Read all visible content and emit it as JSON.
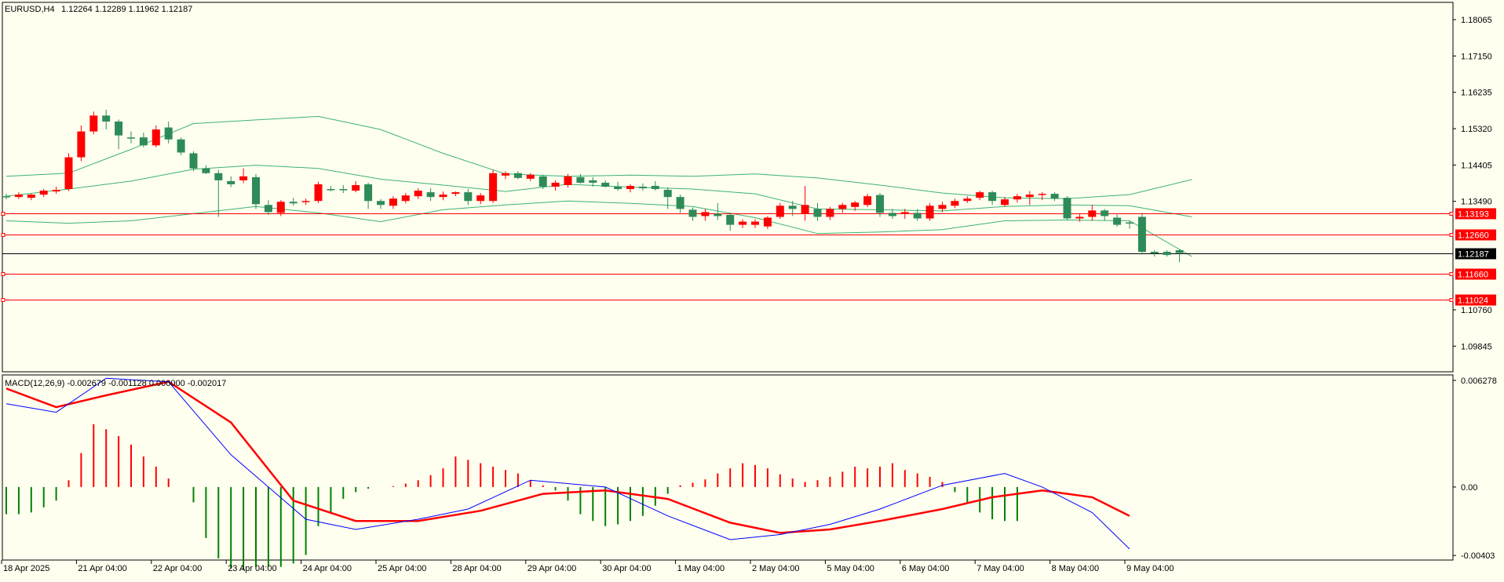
{
  "main_header": {
    "symbol": "EURUSD,H4",
    "ohlc": "1.12264 1.12289 1.11962 1.12187"
  },
  "macd_header": {
    "label": "MACD(12,26,9) -0.002679 -0.001128 0.000000 -0.002017"
  },
  "colors": {
    "background": "#fffff0",
    "bull": "#2e8b57",
    "bear": "#ff0000",
    "band": "#3cb371",
    "level_line": "#ff0000",
    "price_line": "#000000",
    "macd_line": "#0000ff",
    "signal_line": "#ff0000",
    "hist_pos": "#ff0000",
    "hist_neg": "#008000"
  },
  "chart_data": [
    {
      "type": "candlestick",
      "title": "EURUSD,H4",
      "ylim": [
        1.092,
        1.185
      ],
      "y_ticks": [
        "1.18065",
        "1.17150",
        "1.16235",
        "1.15320",
        "1.14405",
        "1.13490",
        "1.10760",
        "1.09845"
      ],
      "y_tick_values": [
        1.18065,
        1.1715,
        1.16235,
        1.1532,
        1.14405,
        1.1349,
        1.1076,
        1.09845
      ],
      "x_labels": [
        "18 Apr 2025",
        "21 Apr 04:00",
        "22 Apr 04:00",
        "23 Apr 04:00",
        "24 Apr 04:00",
        "25 Apr 04:00",
        "28 Apr 04:00",
        "29 Apr 04:00",
        "30 Apr 04:00",
        "1 May 04:00",
        "2 May 04:00",
        "5 May 04:00",
        "6 May 04:00",
        "7 May 04:00",
        "8 May 04:00",
        "9 May 04:00"
      ],
      "x_label_bars": [
        0,
        6,
        12,
        18,
        24,
        30,
        36,
        42,
        48,
        54,
        60,
        66,
        72,
        78,
        84,
        90
      ],
      "candles": [
        [
          1.1362,
          1.1368,
          1.1354,
          1.136
        ],
        [
          1.136,
          1.1372,
          1.1355,
          1.1366
        ],
        [
          1.1358,
          1.1368,
          1.1352,
          1.1366
        ],
        [
          1.1366,
          1.138,
          1.136,
          1.1376
        ],
        [
          1.1374,
          1.1386,
          1.1368,
          1.1378
        ],
        [
          1.138,
          1.147,
          1.1375,
          1.146
        ],
        [
          1.146,
          1.154,
          1.145,
          1.1525
        ],
        [
          1.1525,
          1.1575,
          1.1518,
          1.1565
        ],
        [
          1.1565,
          1.158,
          1.153,
          1.155
        ],
        [
          1.155,
          1.1555,
          1.148,
          1.1515
        ],
        [
          1.151,
          1.1525,
          1.1495,
          1.1508
        ],
        [
          1.151,
          1.1522,
          1.1485,
          1.149
        ],
        [
          1.149,
          1.154,
          1.1485,
          1.153
        ],
        [
          1.1535,
          1.155,
          1.1495,
          1.1505
        ],
        [
          1.1505,
          1.151,
          1.1465,
          1.1472
        ],
        [
          1.147,
          1.1475,
          1.1425,
          1.1432
        ],
        [
          1.1432,
          1.144,
          1.1418,
          1.142
        ],
        [
          1.142,
          1.1428,
          1.131,
          1.1402
        ],
        [
          1.14,
          1.1412,
          1.1385,
          1.1392
        ],
        [
          1.1402,
          1.1432,
          1.1395,
          1.1412
        ],
        [
          1.141,
          1.1418,
          1.133,
          1.1342
        ],
        [
          1.134,
          1.1352,
          1.1315,
          1.1322
        ],
        [
          1.132,
          1.1352,
          1.1312,
          1.1348
        ],
        [
          1.1348,
          1.1358,
          1.1338,
          1.1344
        ],
        [
          1.1348,
          1.1356,
          1.134,
          1.135
        ],
        [
          1.135,
          1.1398,
          1.1345,
          1.1392
        ],
        [
          1.138,
          1.1388,
          1.1374,
          1.1378
        ],
        [
          1.138,
          1.139,
          1.137,
          1.1378
        ],
        [
          1.1376,
          1.14,
          1.1372,
          1.139
        ],
        [
          1.1392,
          1.1396,
          1.133,
          1.135
        ],
        [
          1.135,
          1.1355,
          1.133,
          1.134
        ],
        [
          1.1338,
          1.1362,
          1.133,
          1.1356
        ],
        [
          1.135,
          1.137,
          1.1344,
          1.1364
        ],
        [
          1.1362,
          1.1382,
          1.1355,
          1.1376
        ],
        [
          1.1372,
          1.1382,
          1.135,
          1.136
        ],
        [
          1.136,
          1.1374,
          1.1352,
          1.1366
        ],
        [
          1.1368,
          1.1374,
          1.1362,
          1.1372
        ],
        [
          1.1372,
          1.138,
          1.134,
          1.135
        ],
        [
          1.135,
          1.137,
          1.1342,
          1.1364
        ],
        [
          1.135,
          1.1428,
          1.1345,
          1.142
        ],
        [
          1.1414,
          1.1425,
          1.1405,
          1.142
        ],
        [
          1.142,
          1.1425,
          1.1405,
          1.1408
        ],
        [
          1.1406,
          1.142,
          1.14,
          1.1416
        ],
        [
          1.1412,
          1.1416,
          1.138,
          1.1386
        ],
        [
          1.1386,
          1.1402,
          1.1376,
          1.1396
        ],
        [
          1.139,
          1.1418,
          1.1384,
          1.1412
        ],
        [
          1.141,
          1.1418,
          1.1394,
          1.1396
        ],
        [
          1.1402,
          1.141,
          1.1386,
          1.1396
        ],
        [
          1.1396,
          1.1402,
          1.1384,
          1.1386
        ],
        [
          1.1386,
          1.1398,
          1.1376,
          1.138
        ],
        [
          1.138,
          1.1392,
          1.1372,
          1.1388
        ],
        [
          1.1386,
          1.1394,
          1.1376,
          1.1382
        ],
        [
          1.1388,
          1.14,
          1.1376,
          1.138
        ],
        [
          1.1378,
          1.1384,
          1.133,
          1.136
        ],
        [
          1.136,
          1.1366,
          1.132,
          1.133
        ],
        [
          1.1328,
          1.1334,
          1.13,
          1.131
        ],
        [
          1.1312,
          1.133,
          1.13,
          1.1322
        ],
        [
          1.1318,
          1.1345,
          1.1302,
          1.1312
        ],
        [
          1.1315,
          1.132,
          1.1275,
          1.129
        ],
        [
          1.129,
          1.1304,
          1.1282,
          1.1298
        ],
        [
          1.129,
          1.1304,
          1.1282,
          1.1298
        ],
        [
          1.1286,
          1.1312,
          1.128,
          1.1308
        ],
        [
          1.131,
          1.1345,
          1.1305,
          1.1338
        ],
        [
          1.1338,
          1.135,
          1.1312,
          1.133
        ],
        [
          1.1318,
          1.1388,
          1.13,
          1.134
        ],
        [
          1.133,
          1.1345,
          1.13,
          1.131
        ],
        [
          1.131,
          1.1335,
          1.1302,
          1.133
        ],
        [
          1.133,
          1.1345,
          1.132,
          1.134
        ],
        [
          1.1335,
          1.135,
          1.1325,
          1.1346
        ],
        [
          1.134,
          1.1368,
          1.1335,
          1.1362
        ],
        [
          1.1365,
          1.137,
          1.131,
          1.132
        ],
        [
          1.132,
          1.133,
          1.1305,
          1.1312
        ],
        [
          1.132,
          1.133,
          1.1305,
          1.1322
        ],
        [
          1.132,
          1.133,
          1.13,
          1.1306
        ],
        [
          1.1306,
          1.1345,
          1.13,
          1.1338
        ],
        [
          1.133,
          1.1348,
          1.1322,
          1.134
        ],
        [
          1.1338,
          1.1356,
          1.1332,
          1.135
        ],
        [
          1.135,
          1.1362,
          1.1345,
          1.1356
        ],
        [
          1.1358,
          1.1376,
          1.1352,
          1.1372
        ],
        [
          1.1372,
          1.1376,
          1.134,
          1.135
        ],
        [
          1.134,
          1.136,
          1.1336,
          1.1354
        ],
        [
          1.1354,
          1.1368,
          1.1346,
          1.1362
        ],
        [
          1.136,
          1.1375,
          1.134,
          1.1366
        ],
        [
          1.1366,
          1.1372,
          1.1352,
          1.1368
        ],
        [
          1.1368,
          1.1372,
          1.135,
          1.1356
        ],
        [
          1.1358,
          1.1362,
          1.1302,
          1.1306
        ],
        [
          1.1306,
          1.1318,
          1.1298,
          1.131
        ],
        [
          1.131,
          1.134,
          1.13,
          1.1326
        ],
        [
          1.1326,
          1.133,
          1.13,
          1.1312
        ],
        [
          1.1308,
          1.1316,
          1.1285,
          1.129
        ],
        [
          1.1296,
          1.13,
          1.128,
          1.1294
        ],
        [
          1.131,
          1.132,
          1.1215,
          1.1222
        ],
        [
          1.1222,
          1.1226,
          1.121,
          1.1218
        ],
        [
          1.1222,
          1.1226,
          1.121,
          1.1214
        ],
        [
          1.1226,
          1.1229,
          1.1196,
          1.1219
        ]
      ],
      "bands": {
        "upper": [
          [
            0,
            1.1412
          ],
          [
            5,
            1.142
          ],
          [
            10,
            1.148
          ],
          [
            15,
            1.1545
          ],
          [
            20,
            1.1554
          ],
          [
            25,
            1.1563
          ],
          [
            30,
            1.153
          ],
          [
            35,
            1.147
          ],
          [
            40,
            1.1418
          ],
          [
            45,
            1.1412
          ],
          [
            50,
            1.1415
          ],
          [
            55,
            1.1412
          ],
          [
            60,
            1.1418
          ],
          [
            65,
            1.1408
          ],
          [
            70,
            1.139
          ],
          [
            75,
            1.137
          ],
          [
            80,
            1.1358
          ],
          [
            85,
            1.1356
          ],
          [
            90,
            1.1366
          ],
          [
            95,
            1.1404
          ]
        ],
        "middle": [
          [
            0,
            1.1362
          ],
          [
            5,
            1.138
          ],
          [
            10,
            1.14
          ],
          [
            15,
            1.143
          ],
          [
            20,
            1.144
          ],
          [
            25,
            1.1432
          ],
          [
            30,
            1.1405
          ],
          [
            35,
            1.139
          ],
          [
            40,
            1.1374
          ],
          [
            45,
            1.1392
          ],
          [
            50,
            1.1385
          ],
          [
            55,
            1.138
          ],
          [
            60,
            1.1368
          ],
          [
            65,
            1.133
          ],
          [
            70,
            1.1328
          ],
          [
            75,
            1.1325
          ],
          [
            80,
            1.1336
          ],
          [
            85,
            1.134
          ],
          [
            90,
            1.1338
          ],
          [
            95,
            1.131
          ]
        ],
        "lower": [
          [
            0,
            1.13
          ],
          [
            5,
            1.1294
          ],
          [
            10,
            1.13
          ],
          [
            15,
            1.1318
          ],
          [
            20,
            1.1336
          ],
          [
            25,
            1.132
          ],
          [
            30,
            1.1298
          ],
          [
            35,
            1.1328
          ],
          [
            40,
            1.134
          ],
          [
            45,
            1.135
          ],
          [
            50,
            1.1344
          ],
          [
            55,
            1.1336
          ],
          [
            60,
            1.1308
          ],
          [
            65,
            1.1268
          ],
          [
            70,
            1.1272
          ],
          [
            75,
            1.1278
          ],
          [
            80,
            1.13
          ],
          [
            85,
            1.1302
          ],
          [
            90,
            1.13
          ],
          [
            95,
            1.121
          ]
        ]
      },
      "levels": [
        {
          "value": 1.13193,
          "label": "1.13193",
          "kind": "level"
        },
        {
          "value": 1.1266,
          "label": "1.12660",
          "kind": "level"
        },
        {
          "value": 1.12187,
          "label": "1.12187",
          "kind": "price"
        },
        {
          "value": 1.1166,
          "label": "1.11660",
          "kind": "level"
        },
        {
          "value": 1.11024,
          "label": "1.11024",
          "kind": "level"
        }
      ]
    },
    {
      "type": "bar",
      "title": "MACD(12,26,9)",
      "ylim": [
        -0.0043,
        0.0066
      ],
      "y_ticks": [
        "0.006278",
        "0.00",
        "-0.00403"
      ],
      "y_tick_values": [
        0.006278,
        0.0,
        -0.00403
      ],
      "histogram": [
        -0.0016,
        -0.0016,
        -0.0015,
        -0.0012,
        -0.0008,
        0.0004,
        0.002,
        0.0037,
        0.0034,
        0.003,
        0.0025,
        0.0018,
        0.0012,
        0.0005,
        0.0,
        -0.0009,
        -0.003,
        -0.0042,
        -0.0048,
        -0.0049,
        -0.0047,
        -0.0047,
        -0.0047,
        -0.0045,
        -0.004,
        -0.0023,
        -0.0015,
        -0.0007,
        -0.0003,
        -0.0001,
        0.0,
        5e-05,
        0.0002,
        0.0004,
        0.0007,
        0.0011,
        0.0018,
        0.0016,
        0.0014,
        0.0012,
        0.001,
        0.0008,
        0.0004,
        0.0001,
        -0.0002,
        -0.0008,
        -0.0016,
        -0.002,
        -0.0023,
        -0.0022,
        -0.002,
        -0.0017,
        -0.0011,
        -0.0004,
        0.0001,
        0.00025,
        0.00045,
        0.0008,
        0.0011,
        0.0014,
        0.0013,
        0.0011,
        0.00075,
        0.0005,
        0.0003,
        0.0004,
        0.0006,
        0.0009,
        0.0012,
        0.0011,
        0.0012,
        0.0014,
        0.001,
        0.0008,
        0.0006,
        0.0003,
        -0.0003,
        -0.0009,
        -0.0015,
        -0.0019,
        -0.002,
        -0.002
      ],
      "macd_line": [
        [
          0,
          0.0049
        ],
        [
          4,
          0.0044
        ],
        [
          8,
          0.0064
        ],
        [
          13,
          0.0062
        ],
        [
          18,
          0.0019
        ],
        [
          24,
          -0.0019
        ],
        [
          28,
          -0.0025
        ],
        [
          33,
          -0.0019
        ],
        [
          37,
          -0.0013
        ],
        [
          42,
          0.0004
        ],
        [
          48,
          0.0
        ],
        [
          53,
          -0.0017
        ],
        [
          58,
          -0.0031
        ],
        [
          62,
          -0.0028
        ],
        [
          66,
          -0.0022
        ],
        [
          70,
          -0.0013
        ],
        [
          75,
          0.0001
        ],
        [
          80,
          0.0008
        ],
        [
          83,
          0.0
        ],
        [
          87,
          -0.0015
        ],
        [
          90,
          -0.00365
        ]
      ],
      "signal_line": [
        [
          0,
          0.0058
        ],
        [
          4,
          0.0047
        ],
        [
          8,
          0.0054
        ],
        [
          13,
          0.0062
        ],
        [
          18,
          0.0038
        ],
        [
          23,
          -0.0008
        ],
        [
          28,
          -0.002
        ],
        [
          33,
          -0.002
        ],
        [
          38,
          -0.0014
        ],
        [
          43,
          -0.0004
        ],
        [
          48,
          -0.0002
        ],
        [
          53,
          -0.0007
        ],
        [
          58,
          -0.0021
        ],
        [
          62,
          -0.0027
        ],
        [
          66,
          -0.0025
        ],
        [
          70,
          -0.002
        ],
        [
          75,
          -0.0013
        ],
        [
          79,
          -0.0006
        ],
        [
          83,
          -0.0002
        ],
        [
          87,
          -0.0006
        ],
        [
          90,
          -0.0017
        ]
      ]
    }
  ]
}
